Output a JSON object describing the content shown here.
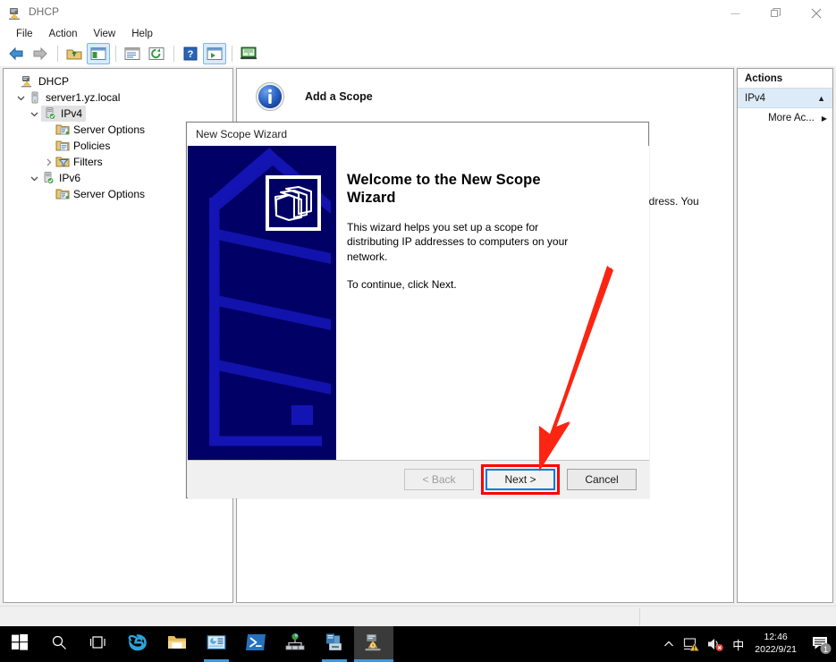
{
  "window": {
    "title": "DHCP",
    "icon": "dhcp-server-icon",
    "buttons": {
      "minimize": "—",
      "restore": "❐",
      "close": "✕"
    }
  },
  "menubar": {
    "items": [
      "File",
      "Action",
      "View",
      "Help"
    ]
  },
  "toolbar": {
    "items": [
      {
        "name": "back-button",
        "icon": "left-arrow-icon",
        "active": false
      },
      {
        "name": "forward-button",
        "icon": "right-arrow-icon",
        "active": false
      },
      {
        "name": "up-folder-button",
        "icon": "up-folder-icon",
        "active": false
      },
      {
        "name": "show-hide-tree-button",
        "icon": "tree-pane-icon",
        "active": true
      },
      {
        "name": "properties-button",
        "icon": "properties-icon",
        "active": false
      },
      {
        "name": "refresh-button",
        "icon": "refresh-icon",
        "active": false
      },
      {
        "name": "help-button",
        "icon": "question-mark-icon",
        "active": false
      },
      {
        "name": "export-list-button",
        "icon": "export-list-icon",
        "active": true
      },
      {
        "name": "show-help-button",
        "icon": "help-book-icon",
        "active": false
      }
    ]
  },
  "tree": {
    "items": [
      {
        "label": "DHCP",
        "indent": 0,
        "twisty": "",
        "icon": "dhcp-root-icon",
        "selected": false
      },
      {
        "label": "server1.yz.local",
        "indent": 1,
        "twisty": "expanded",
        "icon": "server-icon",
        "selected": false
      },
      {
        "label": "IPv4",
        "indent": 2,
        "twisty": "expanded",
        "icon": "ipv4-node-icon",
        "selected": true
      },
      {
        "label": "Server Options",
        "indent": 4,
        "twisty": "",
        "icon": "server-options-icon",
        "selected": false
      },
      {
        "label": "Policies",
        "indent": 4,
        "twisty": "",
        "icon": "policies-icon",
        "selected": false
      },
      {
        "label": "Filters",
        "indent": 3,
        "twisty": "collapsed",
        "icon": "filters-icon",
        "selected": false
      },
      {
        "label": "IPv6",
        "indent": 2,
        "twisty": "expanded",
        "icon": "ipv6-node-icon",
        "selected": false
      },
      {
        "label": "Server Options",
        "indent": 4,
        "twisty": "",
        "icon": "server-options-icon",
        "selected": false
      }
    ]
  },
  "main": {
    "heading": "Add a Scope",
    "heading_icon": "info-icon",
    "occluded_text": "ldress. You"
  },
  "actions": {
    "header": "Actions",
    "group_label": "IPv4",
    "group_caret": "▲",
    "more_actions_label": "More Ac...",
    "more_actions_arrow": "▶"
  },
  "wizard": {
    "title": "New Scope Wizard",
    "heading": "Welcome to the New Scope Wizard",
    "paragraph1": "This wizard helps you set up a scope for distributing IP addresses to computers on your network.",
    "paragraph2": "To continue, click Next.",
    "art_icon": "folders-icon",
    "buttons": {
      "back": "< Back",
      "next": "Next >",
      "cancel": "Cancel"
    },
    "highlight_color": "#ff0000",
    "focus_color": "#0078d7"
  },
  "annotation": {
    "arrow": "red-arrow-pointing-to-next-button",
    "color": "#ff2211"
  },
  "taskbar": {
    "items": [
      {
        "name": "start-button",
        "icon": "windows-logo-icon",
        "running": false,
        "active": false
      },
      {
        "name": "search-button",
        "icon": "search-icon",
        "running": false,
        "active": false
      },
      {
        "name": "task-view-button",
        "icon": "task-view-icon",
        "running": false,
        "active": false
      },
      {
        "name": "internet-explorer-button",
        "icon": "internet-explorer-icon",
        "running": false,
        "active": false
      },
      {
        "name": "file-explorer-button",
        "icon": "folder-icon",
        "running": false,
        "active": false
      },
      {
        "name": "server-manager-button",
        "icon": "server-manager-icon",
        "running": true,
        "active": false
      },
      {
        "name": "powershell-button",
        "icon": "powershell-icon",
        "running": false,
        "active": false
      },
      {
        "name": "network-tool-button",
        "icon": "network-nodes-icon",
        "running": false,
        "active": false
      },
      {
        "name": "server-roles-button",
        "icon": "server-roles-icon",
        "running": true,
        "active": false
      },
      {
        "name": "dhcp-button",
        "icon": "dhcp-server-icon",
        "running": true,
        "active": true
      }
    ],
    "tray": {
      "chevron": "∧",
      "network_icon": "network-warning-icon",
      "volume_icon": "volume-muted-icon",
      "ime": "中",
      "time": "12:46",
      "date": "2022/9/21",
      "notification_icon": "notifications-icon",
      "notification_count": "1"
    }
  }
}
